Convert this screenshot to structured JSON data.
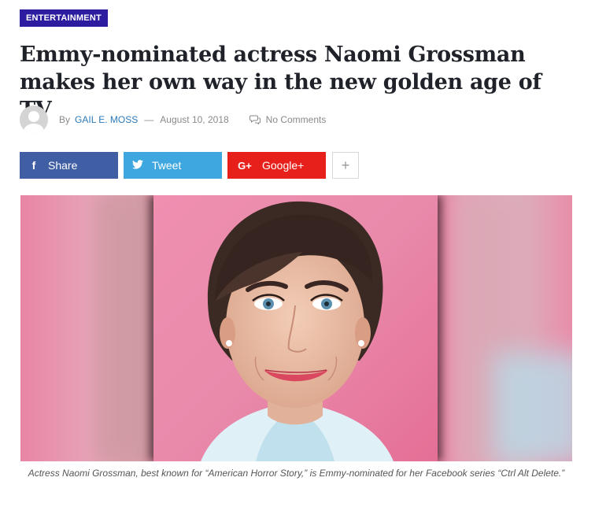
{
  "category": "ENTERTAINMENT",
  "headline": "Emmy-nominated actress Naomi Grossman makes her own way in the new golden age of TV",
  "meta": {
    "by": "By",
    "author": "GAIL E. MOSS",
    "separator": "—",
    "date": "August 10, 2018",
    "comments": "No Comments"
  },
  "share": {
    "facebook": {
      "icon": "f",
      "label": "Share",
      "color": "#3f5ea3"
    },
    "twitter": {
      "icon": "twitter-bird-icon",
      "label": "Tweet",
      "color": "#3ea7e0"
    },
    "google": {
      "icon": "G+",
      "label": "Google+",
      "color": "#e8201b"
    },
    "more": {
      "icon": "+"
    }
  },
  "image": {
    "icon": "portrait-photo"
  },
  "caption": "Actress Naomi Grossman, best known for “American Horror Story,” is Emmy-nominated for her Facebook series “Ctrl Alt Delete.”",
  "colors": {
    "category_bg": "#2c1da0",
    "author_link": "#2c7ab8"
  }
}
